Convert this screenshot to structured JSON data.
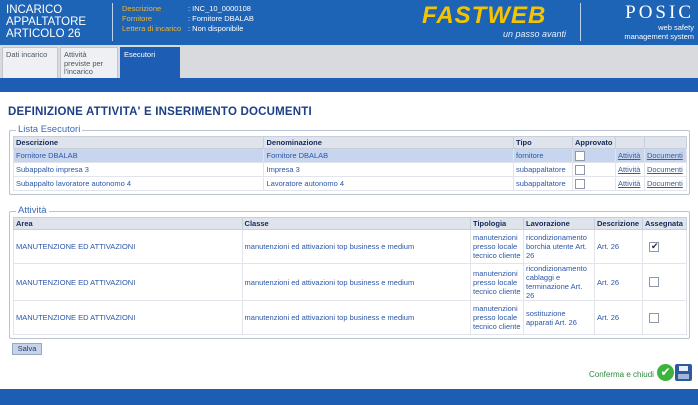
{
  "header": {
    "title_lines": [
      "INCARICO",
      "APPALTATORE",
      "ARTICOLO 26"
    ],
    "info": [
      {
        "label": "Descrizione",
        "value": ": INC_10_0000108"
      },
      {
        "label": "Fornitore",
        "value": ": Fornitore DBALAB"
      },
      {
        "label": "Lettera di incarico",
        "value": ": Non disponibile"
      }
    ],
    "fastweb_logo": "FASTWEB",
    "fastweb_tagline": "un passo avanti",
    "posic_logo": "POSIC",
    "posic_sub": [
      "web safety",
      "management system"
    ]
  },
  "tabs": [
    {
      "label": "Dati incarico",
      "active": false
    },
    {
      "label": "Attività previste per l'incarico",
      "active": false
    },
    {
      "label": "Esecutori",
      "active": true
    }
  ],
  "page_title": "DEFINIZIONE ATTIVITA' E INSERIMENTO DOCUMENTI",
  "esecutori": {
    "legend": "Lista Esecutori",
    "headers": [
      "Descrizione",
      "Denominazione",
      "Tipo",
      "Approvato",
      "",
      ""
    ],
    "rows": [
      {
        "descrizione": "Fornitore DBALAB",
        "denominazione": "Fornitore DBALAB",
        "tipo": "fornitore",
        "approvato": false,
        "attivita": "Attività",
        "documenti": "Documenti"
      },
      {
        "descrizione": "Subappalto impresa 3",
        "denominazione": "Impresa 3",
        "tipo": "subappaltatore",
        "approvato": false,
        "attivita": "Attività",
        "documenti": "Documenti"
      },
      {
        "descrizione": "Subappalto lavoratore autonomo 4",
        "denominazione": "Lavoratore autonomo 4",
        "tipo": "subappaltatore",
        "approvato": false,
        "attivita": "Attività",
        "documenti": "Documenti"
      }
    ]
  },
  "attivita": {
    "legend": "Attività",
    "headers": [
      "Area",
      "Classe",
      "Tipologia",
      "Lavorazione",
      "Descrizione",
      "Assegnata"
    ],
    "rows": [
      {
        "area": "MANUTENZIONE ED ATTIVAZIONI",
        "classe": "manutenzioni ed attivazioni top business e medium",
        "tipologia": "manutenzioni presso locale tecnico cliente",
        "lavorazione": "ricondizionamento borchia utente Art. 26",
        "descrizione": "Art. 26",
        "assegnata": true
      },
      {
        "area": "MANUTENZIONE ED ATTIVAZIONI",
        "classe": "manutenzioni ed attivazioni top business e medium",
        "tipologia": "manutenzioni presso locale tecnico cliente",
        "lavorazione": "ricondizionamento cablaggi e terminazione Art. 26",
        "descrizione": "Art. 26",
        "assegnata": false
      },
      {
        "area": "MANUTENZIONE ED ATTIVAZIONI",
        "classe": "manutenzioni ed attivazioni top business e medium",
        "tipologia": "manutenzioni presso locale tecnico cliente",
        "lavorazione": "sostituzione apparati Art. 26",
        "descrizione": "Art. 26",
        "assegnata": false
      }
    ]
  },
  "buttons": {
    "save": "Salva",
    "confirm_close": "Conferma e chiudi"
  }
}
